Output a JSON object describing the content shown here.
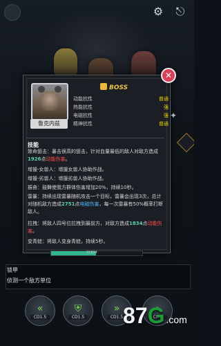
{
  "hud": {
    "pause_icon": "circle-button",
    "gear_icon": "gear-icon",
    "exit_icon": "exit-icon"
  },
  "boss_panel": {
    "badge": "BOSS",
    "name": "鲁克内兹",
    "close_icon": "close-icon",
    "stats": [
      {
        "label": "动能抗性",
        "value": "普通"
      },
      {
        "label": "热能抗性",
        "value": "强"
      },
      {
        "label": "电磁抗性",
        "value": "强"
      },
      {
        "label": "精神抗性",
        "value": "普通"
      }
    ],
    "skills_header": "技能",
    "skills": [
      {
        "prefix": "致命狙击：暴击很高的狙击，针对血量最低的敌人对敌方造成",
        "num": "1926",
        "mid": "点",
        "dmg": "动能伤害",
        "suffix": "。"
      },
      {
        "text": "增援-女兽人：增援女兽人协助作战。"
      },
      {
        "text": "增援-劣兽人：增援劣兽人协助作战。"
      },
      {
        "text": "振奋：鼓舞使我方群体伤害增加20%，持续10秒。"
      },
      {
        "prefix": "雷暴：持续出现雷暴随机攻击一个目标，雷暴会出现3次，总计对随机敌方造成",
        "num": "2751",
        "mid": "点",
        "elec": "电磁伤害",
        "suffix": "，每一次雷暴有50%概率打断敌人。"
      },
      {
        "prefix": "拉拽：将敌人四号位拉拽到最前方，对敌方造成",
        "num": "1834",
        "mid": "点",
        "dmg": "动能伤害",
        "suffix": "。"
      },
      {
        "text": "变青蛙：将敌人变身青蛙，持续5秒。"
      }
    ]
  },
  "hpbar": {
    "fraction": 0.49,
    "label": "21834"
  },
  "message": {
    "title": "锁甲",
    "subtitle": "侦测一个敌方单位"
  },
  "commands": [
    {
      "icon": "left-chevrons-icon",
      "label": "CD1.5"
    },
    {
      "icon": "shield-icon",
      "label": "CD1.5"
    },
    {
      "icon": "right-chevrons-icon",
      "label": "CD1.5"
    },
    {
      "icon": "search-icon",
      "label": "CD3"
    }
  ],
  "watermark": {
    "text": "87",
    "g": "G",
    "com": ".com"
  },
  "colors": {
    "accent": "#f0c24a",
    "value": "#edd300",
    "damage": "#ff4c4c",
    "electro": "#4fb8ff",
    "number": "#5fd3a8",
    "close": "#d9405a"
  }
}
